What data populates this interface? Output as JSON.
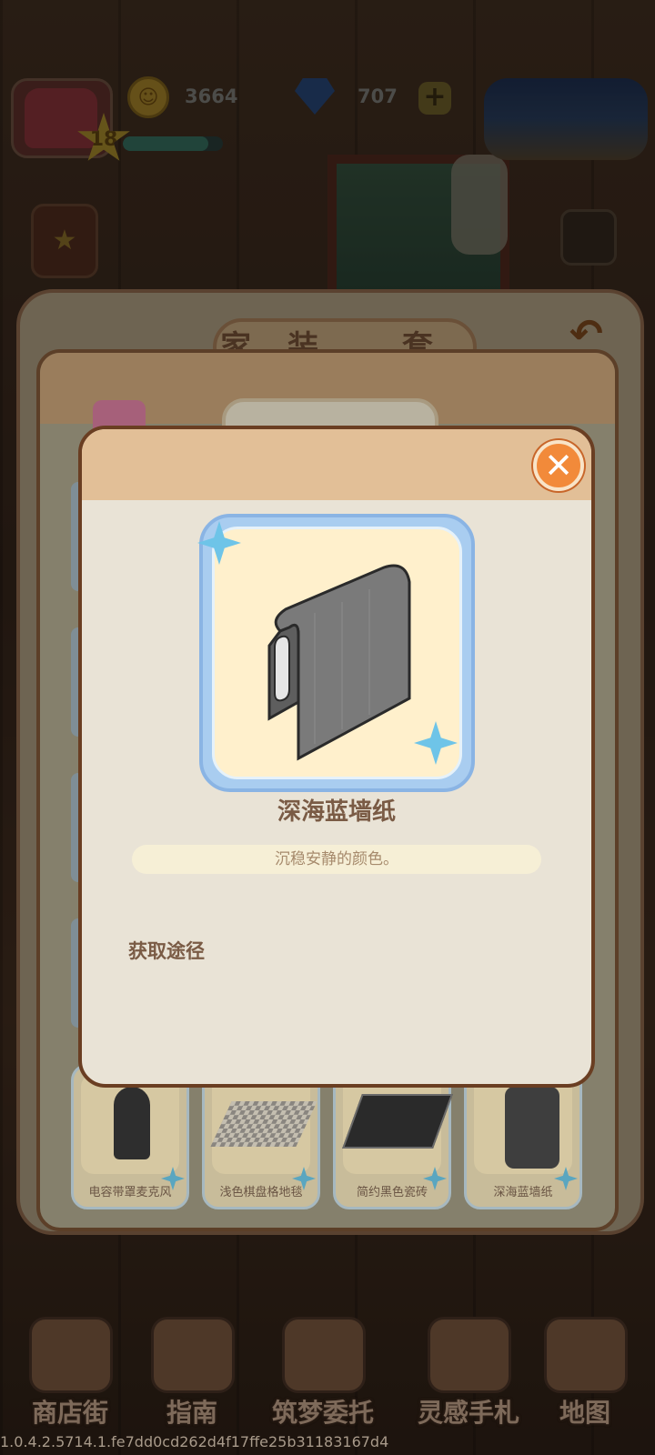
{
  "hud": {
    "level": "18",
    "level_progress": 0.85,
    "coins": "3664",
    "gems": "707",
    "plus_label": "+"
  },
  "back_panel": {
    "title": "家装 套件"
  },
  "dialog": {
    "item_name": "深海蓝墙纸",
    "item_desc": "沉稳安静的颜色。",
    "obtain_label": "获取途径",
    "close_label": "✕"
  },
  "items": [
    {
      "name": "电容带罩麦克风"
    },
    {
      "name": "浅色棋盘格地毯"
    },
    {
      "name": "简约黑色瓷砖"
    },
    {
      "name": "深海蓝墙纸"
    }
  ],
  "nav": [
    {
      "label": "商店街",
      "icon": "shop-icon"
    },
    {
      "label": "指南",
      "icon": "guide-icon"
    },
    {
      "label": "筑梦委托",
      "icon": "commission-icon"
    },
    {
      "label": "灵感手札",
      "icon": "notebook-icon"
    },
    {
      "label": "地图",
      "icon": "map-icon"
    }
  ],
  "build_id": "1.0.4.2.5714.1.fe7dd0cd262d4f17ffe25b31183167d4"
}
